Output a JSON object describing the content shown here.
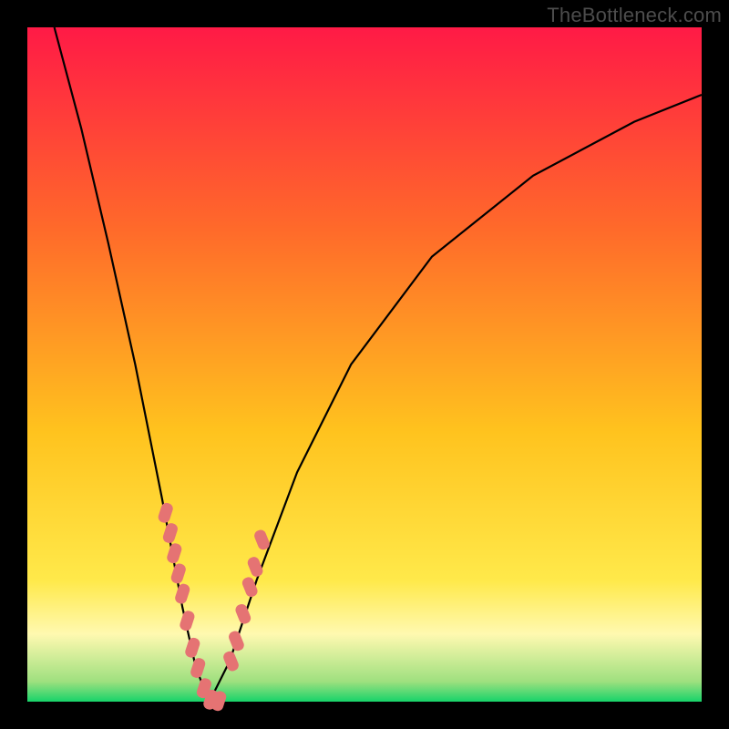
{
  "watermark": "TheBottleneck.com",
  "gradient_colors": {
    "c0": "#ff1a46",
    "c1": "#ff6a2a",
    "c2": "#ffc31e",
    "c3": "#ffe94a",
    "c4": "#fff9b0",
    "c5": "#9fe07f",
    "c6": "#17d36a"
  },
  "marker_color": "#d86a6f",
  "chart_data": {
    "type": "line",
    "title": "",
    "xlabel": "",
    "ylabel": "",
    "xlim": [
      0,
      100
    ],
    "ylim": [
      0,
      100
    ],
    "curve": {
      "description": "V-shaped bottleneck curve; minimum around x≈27, y≈0; left branch reaches top-left, right branch rises toward top-right.",
      "left_branch": [
        {
          "x": 4,
          "y": 100
        },
        {
          "x": 8,
          "y": 85
        },
        {
          "x": 12,
          "y": 68
        },
        {
          "x": 16,
          "y": 50
        },
        {
          "x": 20,
          "y": 30
        },
        {
          "x": 23,
          "y": 14
        },
        {
          "x": 25,
          "y": 5
        },
        {
          "x": 27,
          "y": 0
        }
      ],
      "right_branch": [
        {
          "x": 27,
          "y": 0
        },
        {
          "x": 30,
          "y": 6
        },
        {
          "x": 34,
          "y": 18
        },
        {
          "x": 40,
          "y": 34
        },
        {
          "x": 48,
          "y": 50
        },
        {
          "x": 60,
          "y": 66
        },
        {
          "x": 75,
          "y": 78
        },
        {
          "x": 90,
          "y": 86
        },
        {
          "x": 100,
          "y": 90
        }
      ]
    },
    "markers_left": [
      {
        "x": 20.5,
        "y": 28
      },
      {
        "x": 21.2,
        "y": 25
      },
      {
        "x": 21.8,
        "y": 22
      },
      {
        "x": 22.4,
        "y": 19
      },
      {
        "x": 23.0,
        "y": 16
      },
      {
        "x": 23.7,
        "y": 12
      },
      {
        "x": 24.5,
        "y": 8
      },
      {
        "x": 25.3,
        "y": 5
      },
      {
        "x": 26.2,
        "y": 2
      },
      {
        "x": 27.2,
        "y": 0.3
      },
      {
        "x": 28.4,
        "y": 0.1
      }
    ],
    "markers_right": [
      {
        "x": 30.2,
        "y": 6
      },
      {
        "x": 31.0,
        "y": 9
      },
      {
        "x": 32.0,
        "y": 13
      },
      {
        "x": 33.0,
        "y": 17
      },
      {
        "x": 33.8,
        "y": 20
      },
      {
        "x": 34.8,
        "y": 24
      }
    ]
  }
}
